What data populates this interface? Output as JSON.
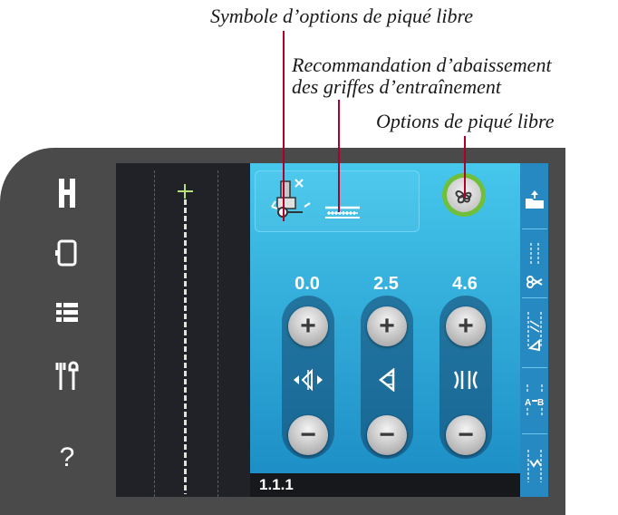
{
  "callouts": {
    "symbol_label": "Symbole d’options de piqué libre",
    "drop_feed_line1": "Recommandation d’abaissement",
    "drop_feed_line2": "des griffes d’entraînement",
    "options_label": "Options de piqué libre"
  },
  "sidebar": {
    "items": [
      {
        "icon": "presser-foot-icon"
      },
      {
        "icon": "bobbin-icon"
      },
      {
        "icon": "menu-grid-icon"
      },
      {
        "icon": "tools-icon"
      },
      {
        "icon": "help-icon",
        "glyph": "?"
      }
    ]
  },
  "controls": [
    {
      "value": "0.0",
      "name": "stitch-position"
    },
    {
      "value": "2.5",
      "name": "stitch-length"
    },
    {
      "value": "4.6",
      "name": "stitch-width"
    }
  ],
  "buttons": {
    "plus": "+",
    "minus": "−"
  },
  "status": {
    "stitch_number": "1.1.1"
  },
  "right_strip": [
    {
      "icon": "folder-icon"
    },
    {
      "icon": "scissors-icon"
    },
    {
      "icon": "tie-off-icon"
    },
    {
      "icon": "ab-sequence-icon"
    },
    {
      "icon": "stitch-pattern-icon"
    }
  ],
  "colors": {
    "panel": "#2aa6db",
    "accent_green": "#6fbf3a",
    "device": "#4a4a4a"
  }
}
